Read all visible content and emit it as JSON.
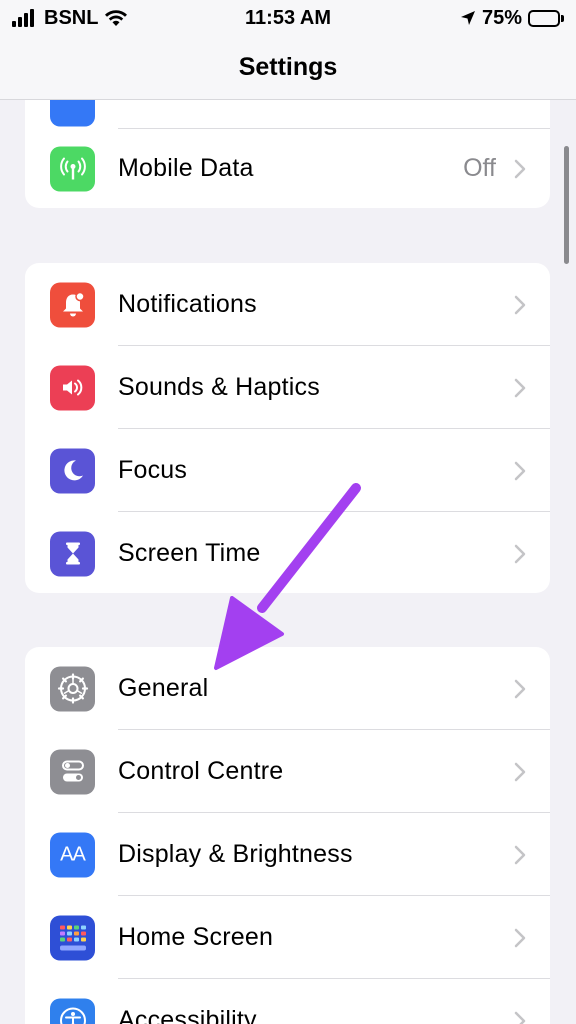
{
  "status_bar": {
    "carrier": "BSNL",
    "time": "11:53 AM",
    "battery_percent": "75%",
    "battery_level": 0.75
  },
  "nav": {
    "title": "Settings"
  },
  "group1": {
    "items": [
      {
        "label": "",
        "icon": "partial-blue-icon"
      },
      {
        "label": "Mobile Data",
        "value": "Off",
        "icon": "antenna-icon",
        "color": "#4cd964"
      }
    ]
  },
  "group2": {
    "items": [
      {
        "label": "Notifications",
        "icon": "bell-icon",
        "color": "#ef4e3c"
      },
      {
        "label": "Sounds & Haptics",
        "icon": "speaker-icon",
        "color": "#ec3f55"
      },
      {
        "label": "Focus",
        "icon": "moon-icon",
        "color": "#5a54d6"
      },
      {
        "label": "Screen Time",
        "icon": "hourglass-icon",
        "color": "#5a54d6"
      }
    ]
  },
  "group3": {
    "items": [
      {
        "label": "General",
        "icon": "gear-icon",
        "color": "#8e8e93"
      },
      {
        "label": "Control Centre",
        "icon": "toggles-icon",
        "color": "#8e8e93"
      },
      {
        "label": "Display & Brightness",
        "icon": "text-size-icon",
        "text": "AA",
        "color": "#3478f6"
      },
      {
        "label": "Home Screen",
        "icon": "app-grid-icon",
        "color": "#2e4fd6"
      },
      {
        "label": "Accessibility",
        "icon": "accessibility-icon",
        "color": "#2f80ed"
      }
    ]
  },
  "colors": {
    "annotation_arrow": "#a340f0"
  }
}
